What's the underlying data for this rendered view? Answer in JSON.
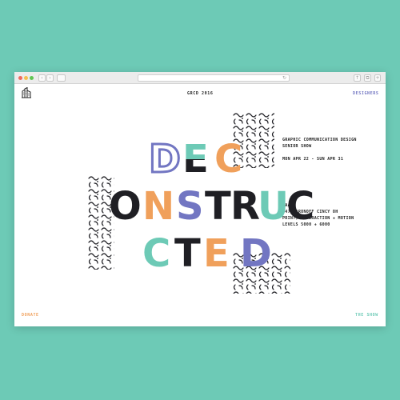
{
  "colors": {
    "background": "#6dcab6",
    "orange": "#f0a05b",
    "blue": "#7276c2",
    "teal": "#6dcab6",
    "dark": "#1f1f24"
  },
  "header": {
    "logo_icon": "building-logo-icon",
    "title": "GRCD 2016",
    "designers": "DESIGNERS"
  },
  "show_info": {
    "line1": "GRAPHIC COMMUNICATION DESIGN",
    "line2": "SENIOR SHOW",
    "dates": "MON APR 22 - SUN APR 31"
  },
  "venue_info": {
    "line1": "DAAP",
    "line2": "6470 ARONOFF CINCY OH",
    "line3": "PRINT, INTERACTION + MOTION",
    "line4": "LEVELS 5000 + 6000"
  },
  "footer": {
    "donate": "DONATE",
    "the_show": "THE SHOW"
  },
  "headline": {
    "line1": [
      "D",
      "E",
      "C"
    ],
    "line2": [
      "O",
      "N",
      "S",
      "T",
      "R",
      "U",
      "C"
    ],
    "line3": [
      "T",
      "E",
      "D"
    ]
  }
}
